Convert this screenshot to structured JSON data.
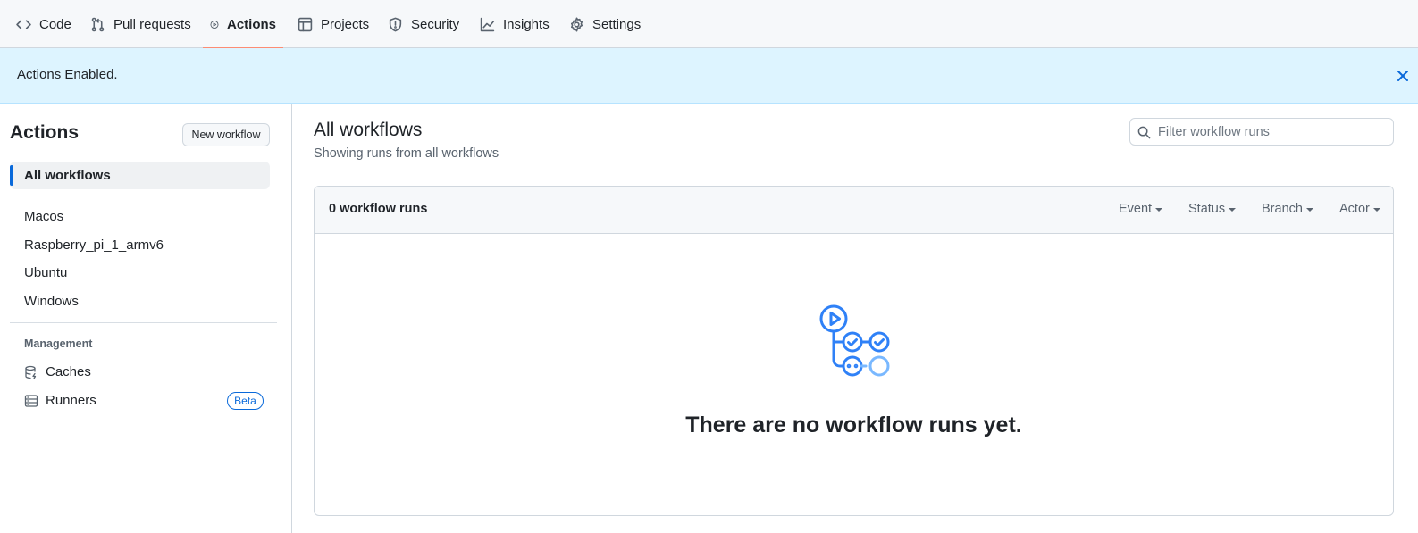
{
  "repo_nav": {
    "tabs": [
      {
        "label": "Code",
        "icon": "code-icon"
      },
      {
        "label": "Pull requests",
        "icon": "git-pull-request-icon"
      },
      {
        "label": "Actions",
        "icon": "play-icon",
        "active": true
      },
      {
        "label": "Projects",
        "icon": "table-icon"
      },
      {
        "label": "Security",
        "icon": "shield-icon"
      },
      {
        "label": "Insights",
        "icon": "graph-icon"
      },
      {
        "label": "Settings",
        "icon": "gear-icon"
      }
    ]
  },
  "flash": {
    "message": "Actions Enabled.",
    "close_icon": "x-icon"
  },
  "sidebar": {
    "title": "Actions",
    "new_workflow_label": "New workflow",
    "all_workflows_label": "All workflows",
    "workflows": [
      "Macos",
      "Raspberry_pi_1_armv6",
      "Ubuntu",
      "Windows"
    ],
    "management_heading": "Management",
    "management_items": [
      {
        "label": "Caches",
        "icon": "database-icon"
      },
      {
        "label": "Runners",
        "icon": "server-icon",
        "badge": "Beta"
      }
    ]
  },
  "main": {
    "title": "All workflows",
    "subtitle": "Showing runs from all workflows",
    "filter_placeholder": "Filter workflow runs",
    "runs_count_label": "0 workflow runs",
    "filters": [
      "Event",
      "Status",
      "Branch",
      "Actor"
    ],
    "blankslate_message": "There are no workflow runs yet.",
    "blankslate_icon": "workflow-icon"
  },
  "colors": {
    "accent": "#0969da",
    "active_tab_underline": "#fd8c73",
    "flash_bg": "#ddf4ff",
    "illustration": "#2f81f7"
  }
}
